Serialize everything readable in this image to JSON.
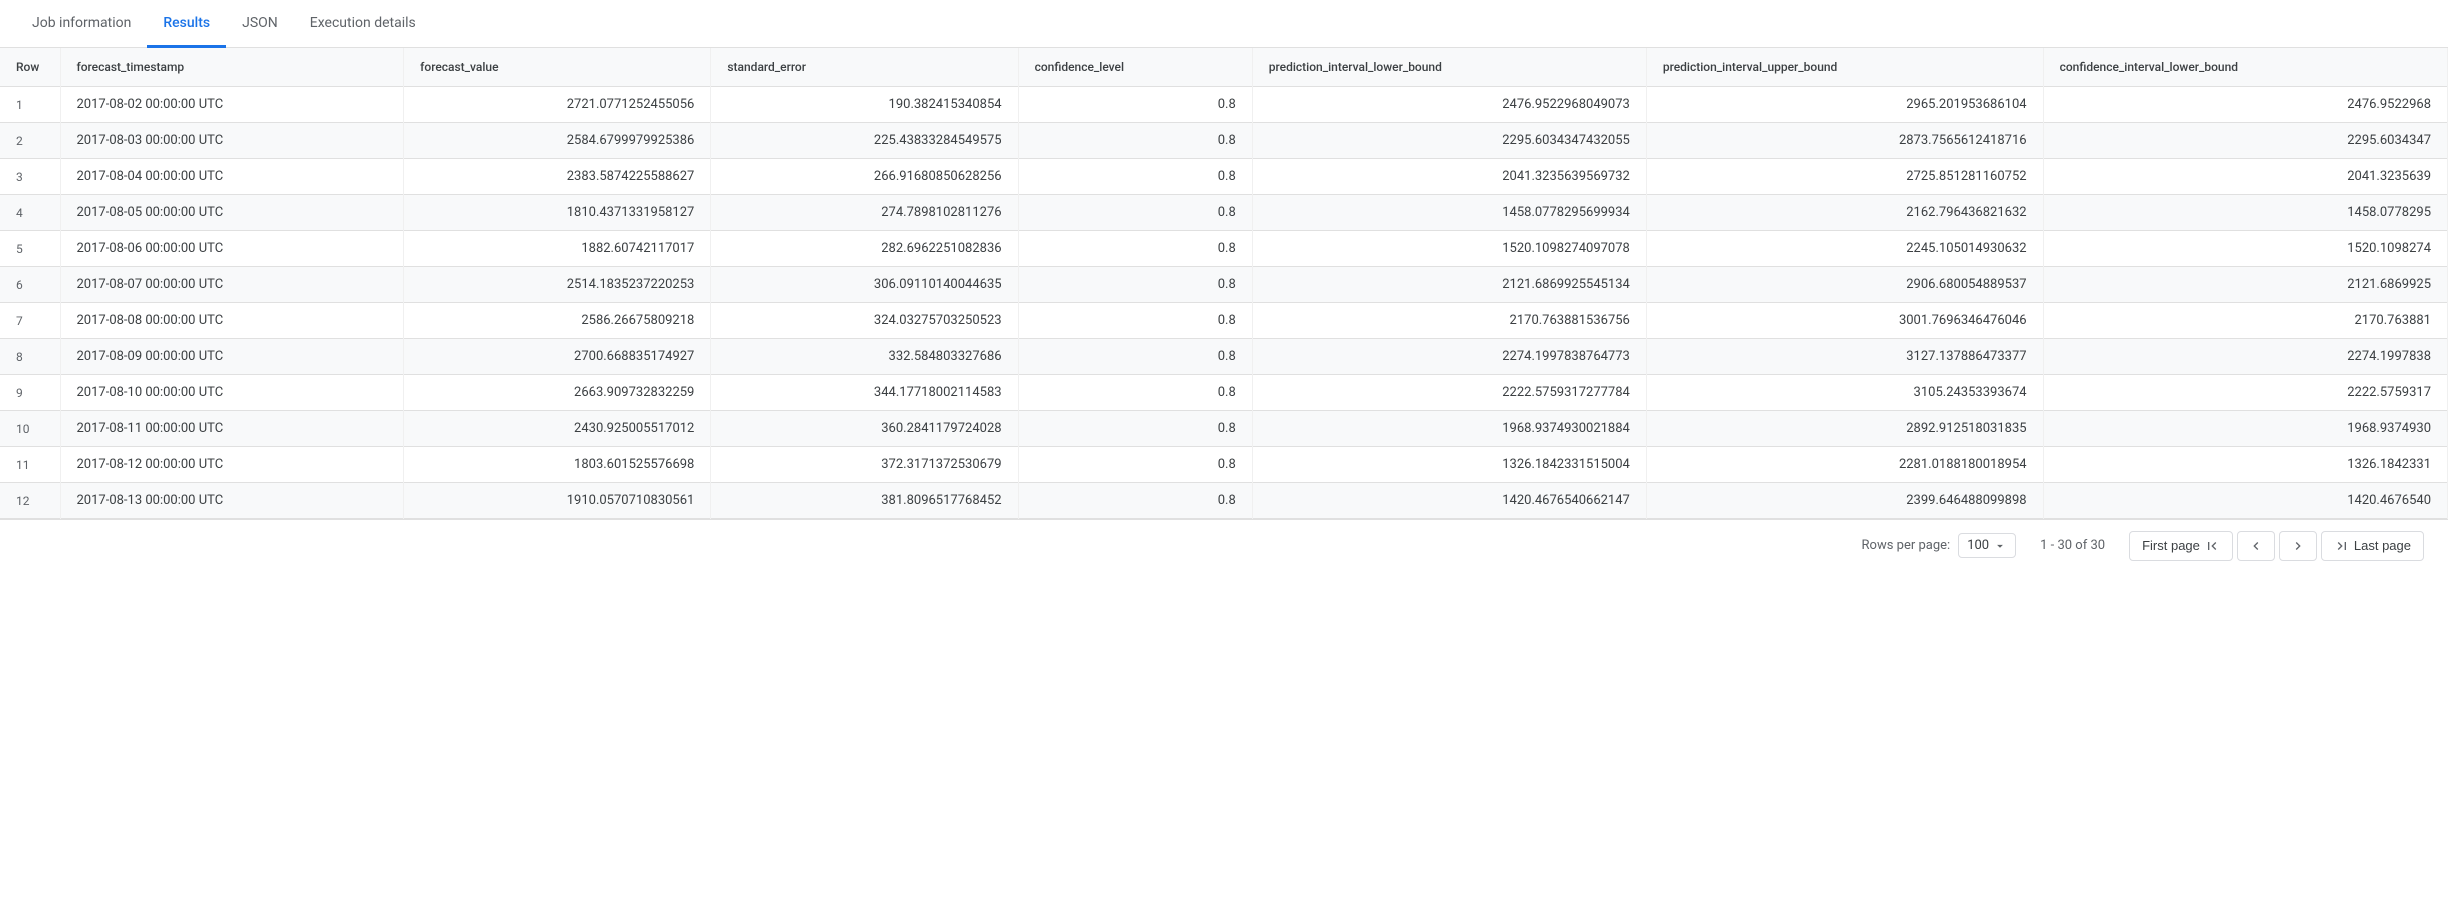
{
  "tabs": [
    {
      "label": "Job information",
      "active": false
    },
    {
      "label": "Results",
      "active": true
    },
    {
      "label": "JSON",
      "active": false
    },
    {
      "label": "Execution details",
      "active": false
    }
  ],
  "table": {
    "columns": [
      "Row",
      "forecast_timestamp",
      "forecast_value",
      "standard_error",
      "confidence_level",
      "prediction_interval_lower_bound",
      "prediction_interval_upper_bound",
      "confidence_interval_lower_bound"
    ],
    "rows": [
      [
        1,
        "2017-08-02 00:00:00 UTC",
        "2721.0771252455056",
        "190.382415340854",
        "0.8",
        "2476.9522968049073",
        "2965.201953686104",
        "2476.9522968"
      ],
      [
        2,
        "2017-08-03 00:00:00 UTC",
        "2584.6799979925386",
        "225.43833284549575",
        "0.8",
        "2295.6034347432055",
        "2873.7565612418716",
        "2295.6034347"
      ],
      [
        3,
        "2017-08-04 00:00:00 UTC",
        "2383.5874225588627",
        "266.91680850628256",
        "0.8",
        "2041.3235639569732",
        "2725.851281160752",
        "2041.3235639"
      ],
      [
        4,
        "2017-08-05 00:00:00 UTC",
        "1810.4371331958127",
        "274.7898102811276",
        "0.8",
        "1458.0778295699934",
        "2162.796436821632",
        "1458.0778295"
      ],
      [
        5,
        "2017-08-06 00:00:00 UTC",
        "1882.60742117017",
        "282.6962251082836",
        "0.8",
        "1520.1098274097078",
        "2245.105014930632",
        "1520.1098274"
      ],
      [
        6,
        "2017-08-07 00:00:00 UTC",
        "2514.1835237220253",
        "306.09110140044635",
        "0.8",
        "2121.6869925545134",
        "2906.680054889537",
        "2121.6869925"
      ],
      [
        7,
        "2017-08-08 00:00:00 UTC",
        "2586.26675809218",
        "324.03275703250523",
        "0.8",
        "2170.763881536756",
        "3001.7696346476046",
        "2170.763881"
      ],
      [
        8,
        "2017-08-09 00:00:00 UTC",
        "2700.668835174927",
        "332.584803327686",
        "0.8",
        "2274.1997838764773",
        "3127.137886473377",
        "2274.1997838"
      ],
      [
        9,
        "2017-08-10 00:00:00 UTC",
        "2663.909732832259",
        "344.17718002114583",
        "0.8",
        "2222.5759317277784",
        "3105.24353393674",
        "2222.5759317"
      ],
      [
        10,
        "2017-08-11 00:00:00 UTC",
        "2430.925005517012",
        "360.2841179724028",
        "0.8",
        "1968.9374930021884",
        "2892.912518031835",
        "1968.9374930"
      ],
      [
        11,
        "2017-08-12 00:00:00 UTC",
        "1803.601525576698",
        "372.3171372530679",
        "0.8",
        "1326.1842331515004",
        "2281.0188180018954",
        "1326.1842331"
      ],
      [
        12,
        "2017-08-13 00:00:00 UTC",
        "1910.0570710830561",
        "381.8096517768452",
        "0.8",
        "1420.4676540662147",
        "2399.646488099898",
        "1420.4676540"
      ]
    ]
  },
  "pagination": {
    "rows_per_page_label": "Rows per page:",
    "rows_per_page_value": "100",
    "page_info": "1 - 30 of 30",
    "first_page_label": "First page",
    "prev_label": "",
    "next_label": "",
    "last_page_label": "Last page"
  }
}
